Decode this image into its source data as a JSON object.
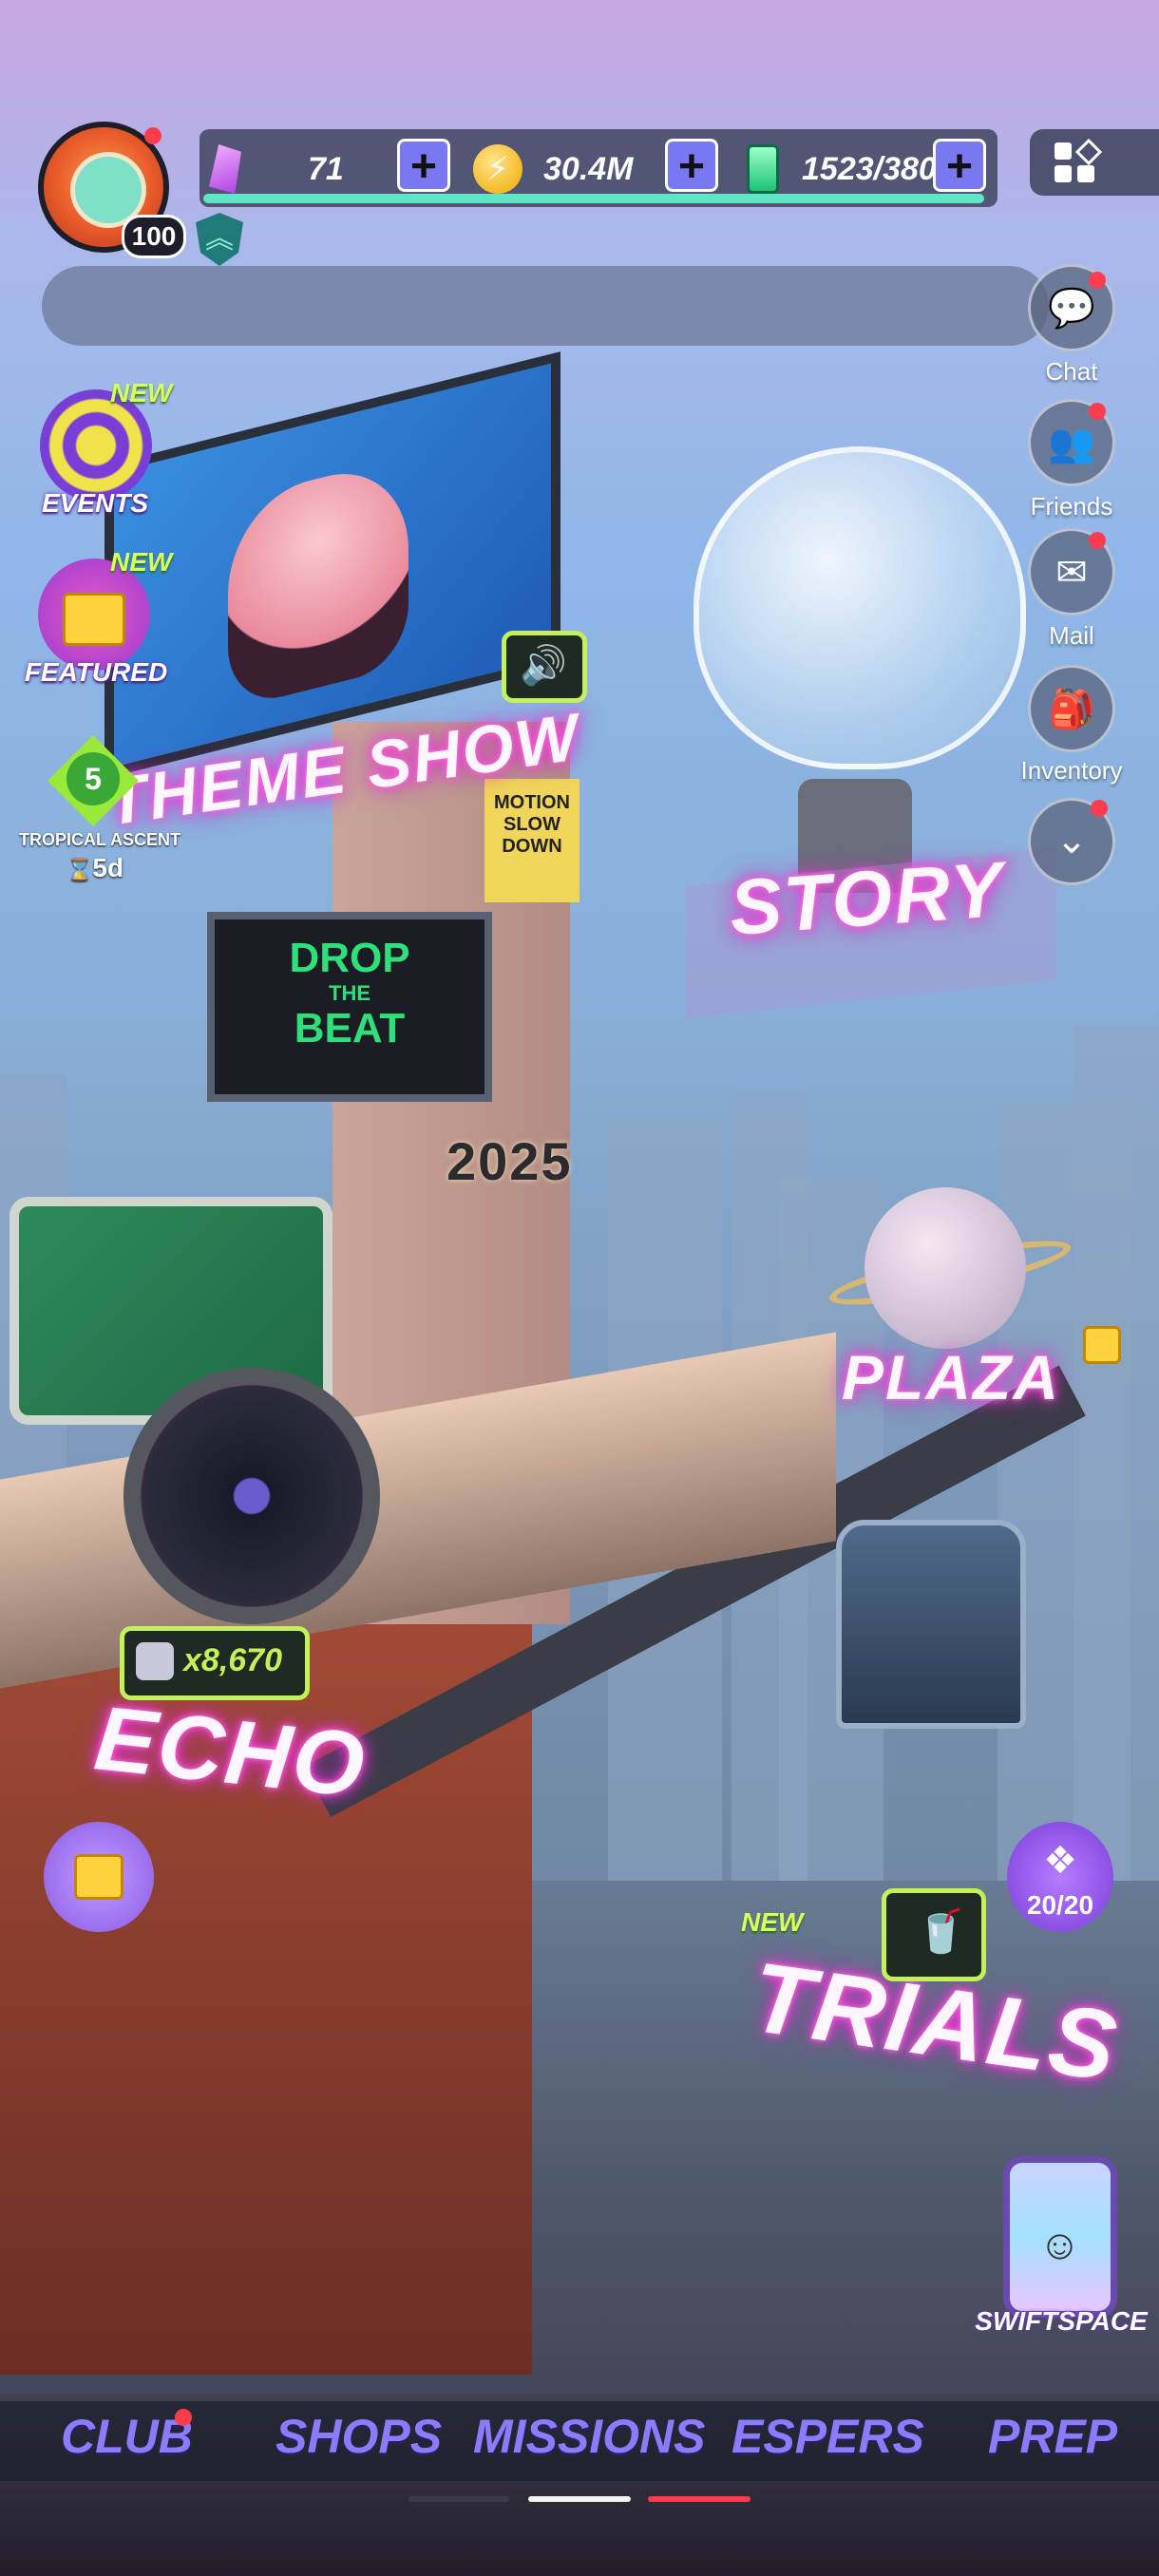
{
  "profile": {
    "level": "100"
  },
  "resources": {
    "gems": "71",
    "coins": "30.4M",
    "energy": "1523/380"
  },
  "side_menu": [
    {
      "label": "Chat",
      "icon": "chat-icon",
      "glyph": "💬"
    },
    {
      "label": "Friends",
      "icon": "friends-icon",
      "glyph": "👥"
    },
    {
      "label": "Mail",
      "icon": "mail-icon",
      "glyph": "✉"
    },
    {
      "label": "Inventory",
      "icon": "inventory-icon",
      "glyph": "🎒"
    }
  ],
  "left_events": {
    "events_label": "EVENTS",
    "featured_label": "FEATURED",
    "new_tag": "NEW",
    "ascent_level": "5",
    "ascent_label": "TROPICAL ASCENT",
    "ascent_timer": "5d"
  },
  "scene": {
    "theme_show": "THEME SHOW",
    "story": "STORY",
    "plaza": "PLAZA",
    "echo": "ECHO",
    "echo_count": "x8,670",
    "trials": "TRIALS",
    "trials_new": "NEW",
    "drop_beat_line1": "DROP",
    "drop_beat_line2": "THE",
    "drop_beat_line3": "BEAT",
    "year_sign": "2025",
    "motion_sign": "MOTION SLOW DOWN"
  },
  "tickets": {
    "label": "20/20"
  },
  "swiftspace": {
    "label": "SWIFTSPACE"
  },
  "bottom_nav": [
    {
      "label": "CLUB"
    },
    {
      "label": "SHOPS"
    },
    {
      "label": "MISSIONS"
    },
    {
      "label": "ESPERS"
    },
    {
      "label": "PREP"
    }
  ],
  "colors": {
    "nav_text": "#8b7cff",
    "neon_pink": "#ff3fd6",
    "accent_green": "#c4f05a",
    "notification": "#ff3b4e"
  }
}
